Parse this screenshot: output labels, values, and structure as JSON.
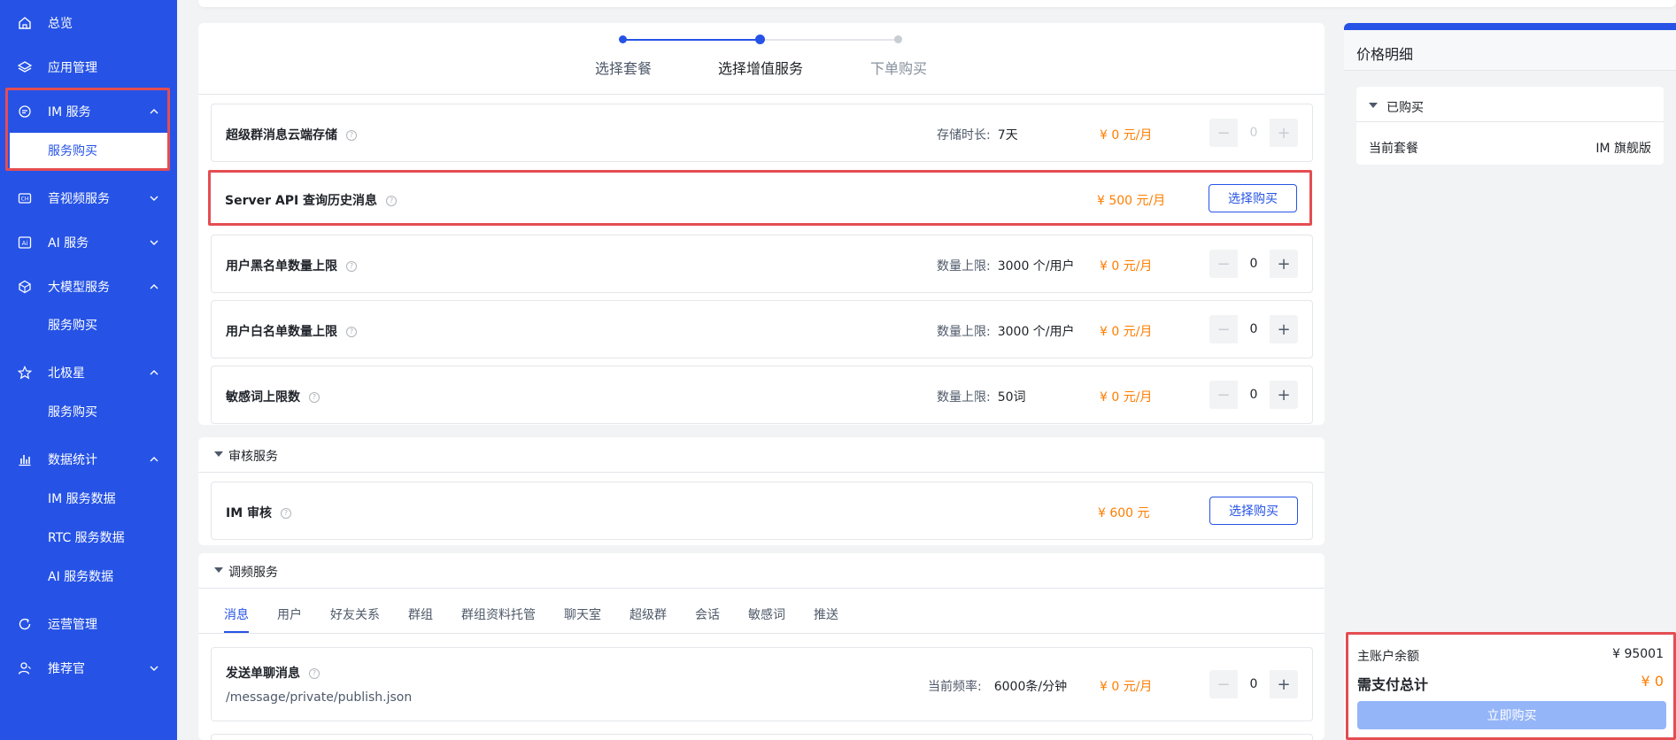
{
  "sidebar": {
    "items": [
      {
        "label": "总览",
        "icon": "home-icon"
      },
      {
        "label": "应用管理",
        "icon": "layers-icon"
      },
      {
        "label": "IM 服务",
        "icon": "chat-icon"
      },
      {
        "label": "音视频服务",
        "icon": "video-icon"
      },
      {
        "label": "AI 服务",
        "icon": "ai-icon"
      },
      {
        "label": "大模型服务",
        "icon": "cube-icon"
      },
      {
        "label": "北极星",
        "icon": "star-icon"
      },
      {
        "label": "数据统计",
        "icon": "bar-chart-icon"
      },
      {
        "label": "运营管理",
        "icon": "refresh-icon"
      },
      {
        "label": "推荐官",
        "icon": "user-icon"
      }
    ],
    "subs": {
      "im_buy": "服务购买",
      "llm_buy": "服务购买",
      "polaris_buy": "服务购买",
      "stat_im": "IM 服务数据",
      "stat_rtc": "RTC 服务数据",
      "stat_ai": "AI 服务数据"
    }
  },
  "steps": [
    "选择套餐",
    "选择增值服务",
    "下单购买"
  ],
  "rows": {
    "supergroup_storage": {
      "title": "超级群消息云端存储",
      "meta_key": "存储时长:",
      "meta_val": "7天",
      "price": "¥ 0 元/月",
      "qty": "0"
    },
    "server_api": {
      "title": "Server API 查询历史消息",
      "price": "¥ 500 元/月",
      "button": "选择购买"
    },
    "blacklist": {
      "title": "用户黑名单数量上限",
      "meta_key": "数量上限:",
      "meta_val": "3000 个/用户",
      "price": "¥ 0 元/月",
      "qty": "0"
    },
    "whitelist": {
      "title": "用户白名单数量上限",
      "meta_key": "数量上限:",
      "meta_val": "3000 个/用户",
      "price": "¥ 0 元/月",
      "qty": "0"
    },
    "sensitive": {
      "title": "敏感词上限数",
      "meta_key": "数量上限:",
      "meta_val": "50词",
      "price": "¥ 0 元/月",
      "qty": "0"
    },
    "im_audit": {
      "title": "IM 审核",
      "price": "¥ 600 元",
      "button": "选择购买"
    },
    "private_msg": {
      "title": "发送单聊消息",
      "path": "/message/private/publish.json",
      "meta_key": "当前频率:",
      "meta_val": "6000条/分钟",
      "price": "¥ 0 元/月",
      "qty": "0"
    }
  },
  "sections": {
    "audit": "审核服务",
    "freq": "调频服务"
  },
  "tabs": [
    "消息",
    "用户",
    "好友关系",
    "群组",
    "群组资料托管",
    "聊天室",
    "超级群",
    "会话",
    "敏感词",
    "推送"
  ],
  "right": {
    "title": "价格明细",
    "bought_label": "已购买",
    "plan_key": "当前套餐",
    "plan_val": "IM 旗舰版",
    "balance_key": "主账户余额",
    "balance_val": "¥ 95001",
    "total_key": "需支付总计",
    "total_val": "¥ 0",
    "pay_button": "立即购买"
  },
  "colors": {
    "sidebar": "#2653e6",
    "accent": "#2653e6",
    "price": "#ff7d00",
    "highlight": "#e44d52"
  }
}
